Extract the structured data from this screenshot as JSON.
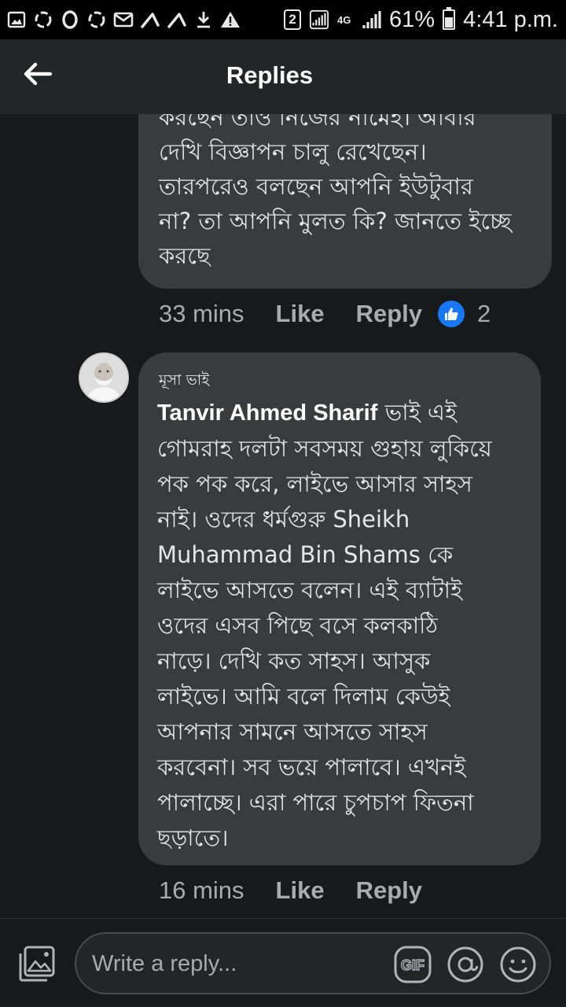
{
  "status_bar": {
    "battery_percent": "61%",
    "time": "4:41 p.m.",
    "network": "4G",
    "sim_slot": "2",
    "battery_level": 0.61
  },
  "header": {
    "title": "Replies"
  },
  "comments": [
    {
      "text_lines": [
        "করছেন তাও নিজের নামেই। আবার",
        "দেখি বিজ্ঞাপন চালু রেখেছেন।",
        "তারপরেও বলছেন আপনি ইউটুবার",
        "না? তা আপনি মুলত কি? জানতে ইচ্ছে",
        "করছে"
      ],
      "time": "33 mins",
      "like_label": "Like",
      "reply_label": "Reply",
      "reaction_count": "2"
    },
    {
      "author": "মূসা ভাই",
      "mention": "Tanvir Ahmed Sharif",
      "text_lines": [
        " ভাই এই",
        "গোমরাহ দলটা সবসময় গুহায় লুকিয়ে",
        "পক পক করে, লাইভে আসার সাহস",
        "নাই। ওদের ধর্মগুরু Sheikh",
        "Muhammad Bin Shams কে",
        "লাইভে আসতে বলেন। এই ব্যাটাই",
        "ওদের এসব পিছে বসে কলকাঠি",
        "নাড়ে। দেখি কত সাহস। আসুক",
        "লাইভে। আমি বলে দিলাম কেউই",
        "আপনার সামনে আসতে সাহস",
        "করবেনা। সব ভয়ে পালাবে। এখনই",
        "পালাচ্ছে। এরা পারে চুপচাপ ফিতনা",
        "ছড়াতে।"
      ],
      "time": "16 mins",
      "like_label": "Like",
      "reply_label": "Reply"
    }
  ],
  "composer": {
    "placeholder": "Write a reply...",
    "gif_label": "GIF"
  },
  "colors": {
    "background": "#18191a",
    "bubble": "#3a3b3c",
    "header": "#242526",
    "like_blue": "#1877f2",
    "meta_text": "#a8abaf"
  }
}
